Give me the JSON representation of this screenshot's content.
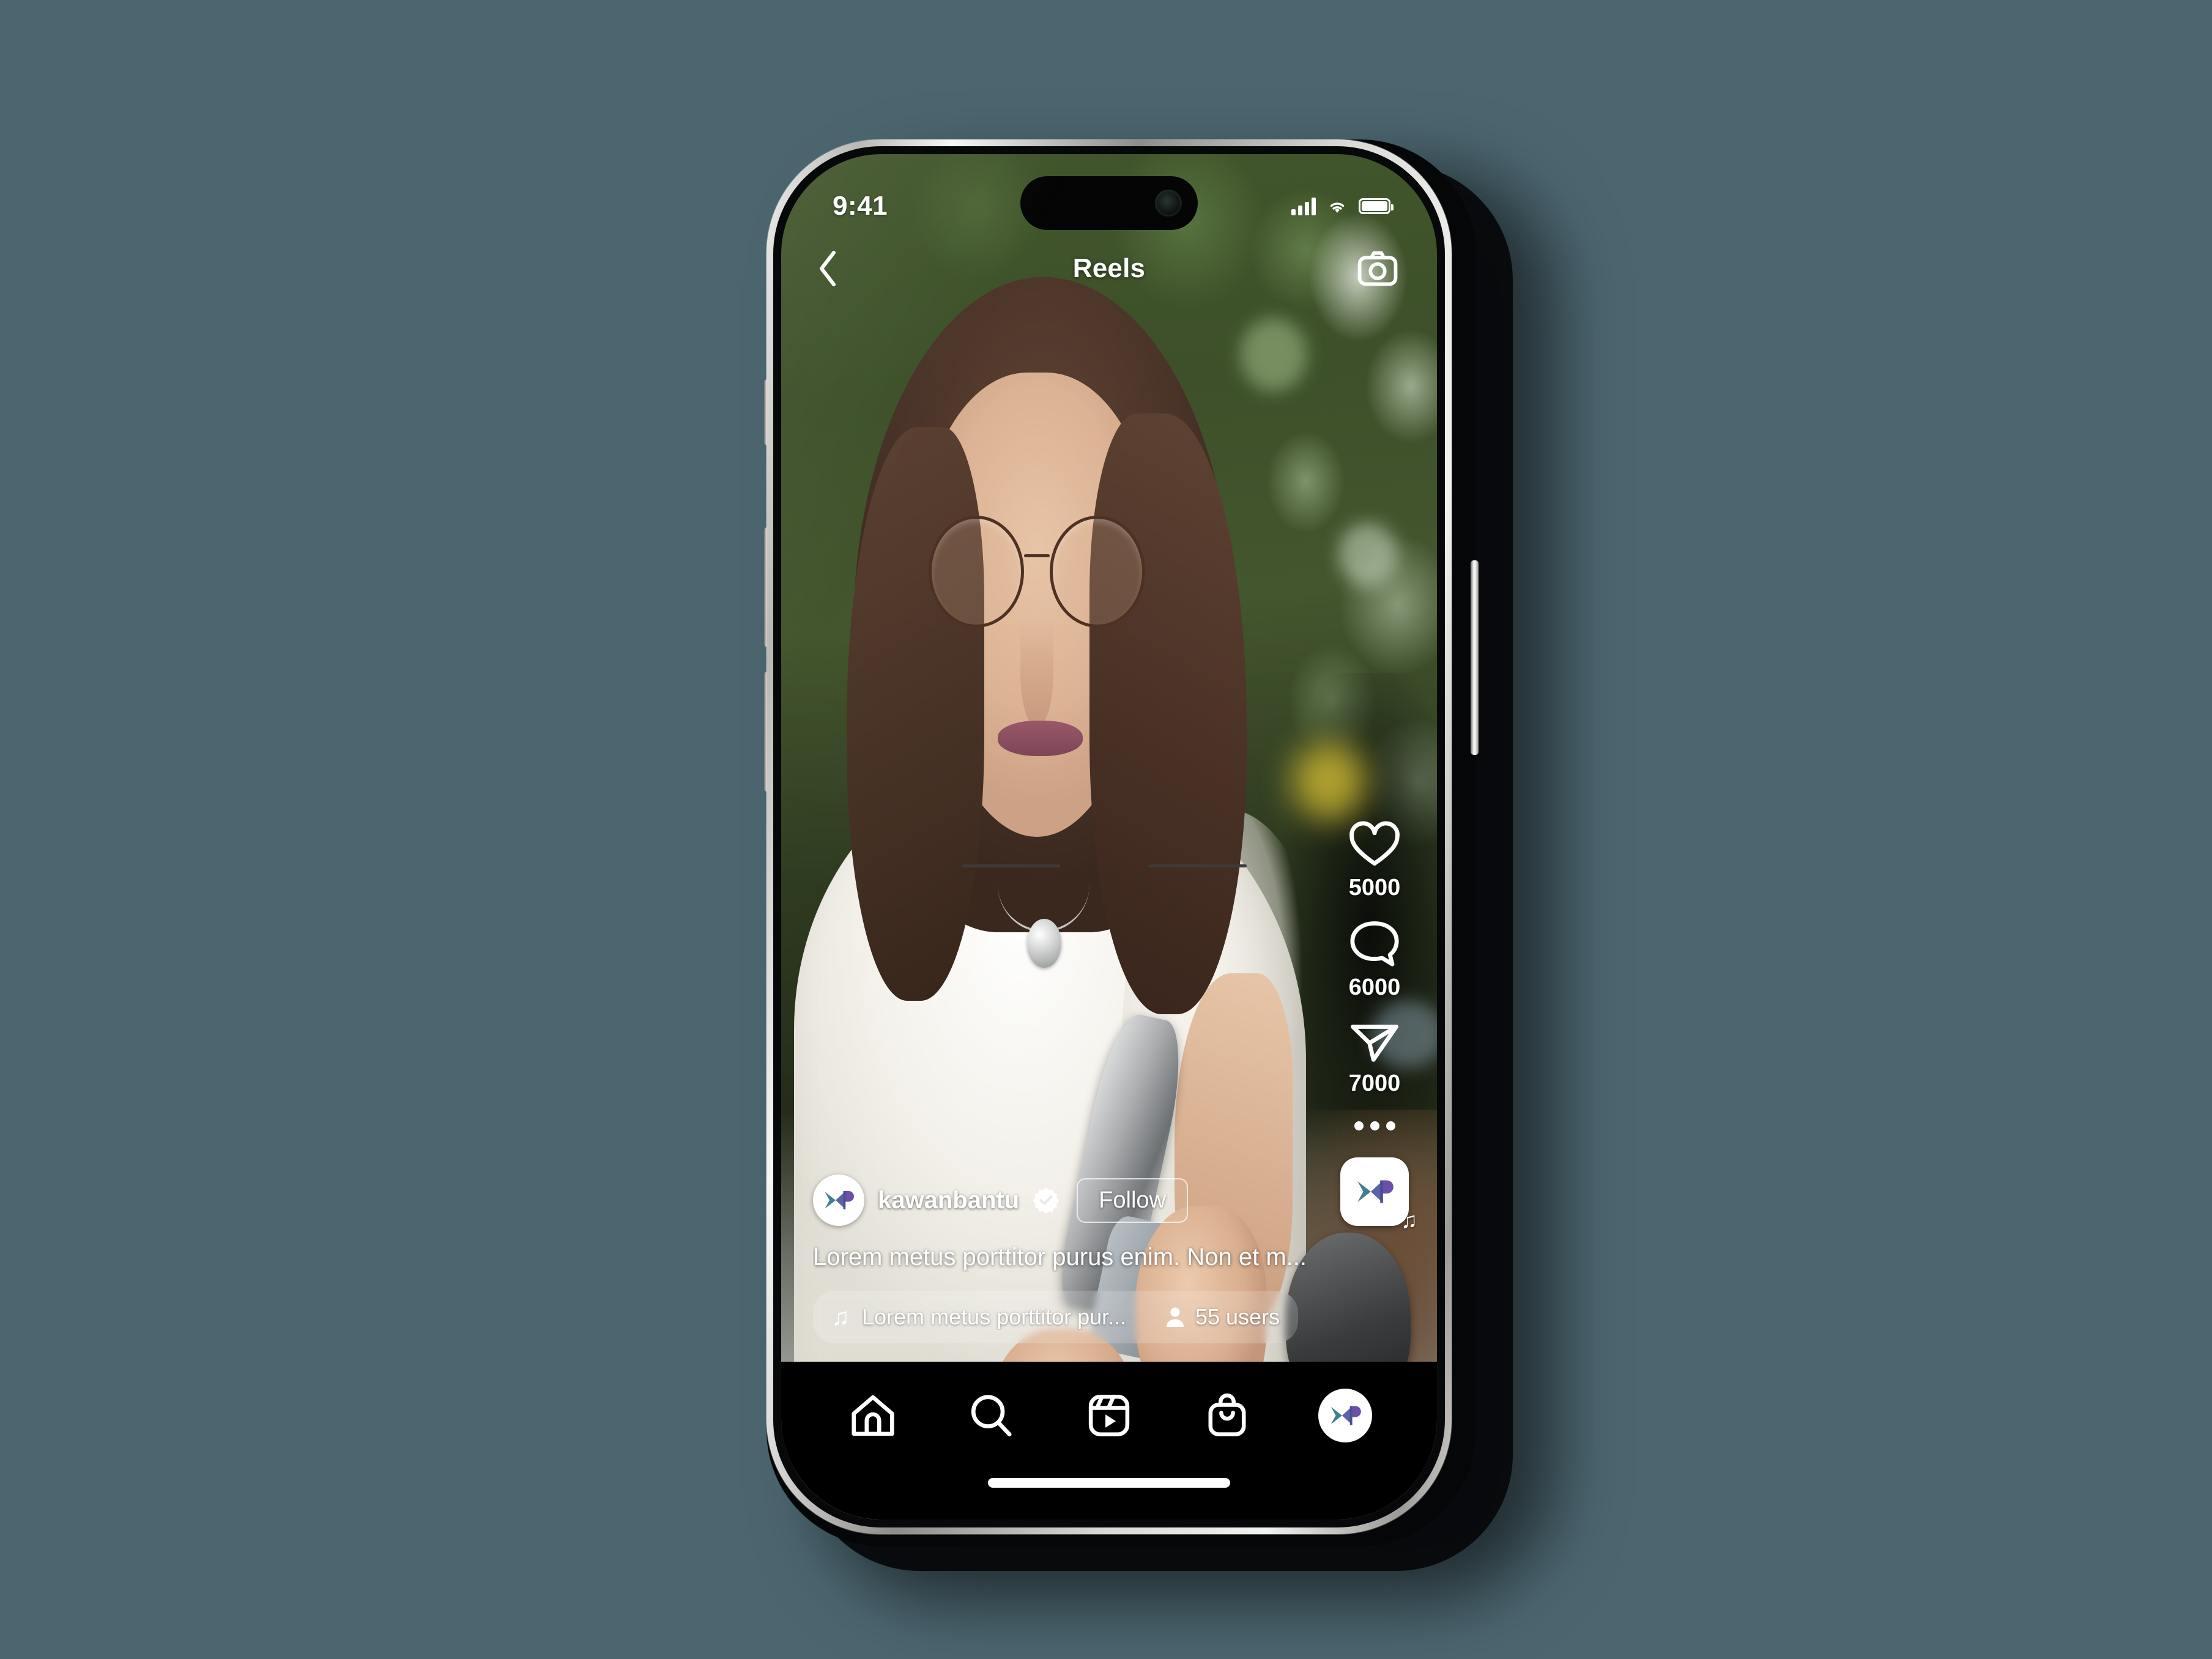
{
  "background_color": "#4c6670",
  "status_bar": {
    "time": "9:41",
    "cellular_icon": "cellular-signal-icon",
    "wifi_icon": "wifi-icon",
    "battery_icon": "battery-icon"
  },
  "header": {
    "back_icon": "chevron-left-icon",
    "title": "Reels",
    "camera_icon": "camera-icon"
  },
  "actions": [
    {
      "icon": "heart-icon",
      "name": "like",
      "count": "5000"
    },
    {
      "icon": "comment-icon",
      "name": "comment",
      "count": "6000"
    },
    {
      "icon": "share-icon",
      "name": "share",
      "count": "7000"
    }
  ],
  "more_icon": "more-options-icon",
  "album": {
    "icon": "album-art-logo",
    "logo_text": "XB",
    "badge_icon": "music-note-icon",
    "badge_glyph": "♫"
  },
  "post": {
    "avatar_logo": "XB",
    "username": "kawanbantu",
    "verified_icon": "verified-badge-icon",
    "follow_label": "Follow",
    "caption": "Lorem metus porttitor purus enim. Non et m...",
    "audio": {
      "music_icon": "music-note-icon",
      "music_glyph": "♫",
      "title": "Lorem metus porttitor pur...",
      "users_icon": "person-icon",
      "users_count": "55 users"
    }
  },
  "tabbar": [
    {
      "icon": "home-icon",
      "name": "home"
    },
    {
      "icon": "search-icon",
      "name": "search"
    },
    {
      "icon": "reels-icon",
      "name": "reels"
    },
    {
      "icon": "shop-icon",
      "name": "shop"
    },
    {
      "icon": "profile-avatar-icon",
      "name": "profile",
      "logo_text": "XB"
    }
  ],
  "brand_colors": {
    "logo_teal": "#3f7f93",
    "logo_purple": "#6b4fa8",
    "accent_yellow": "#d9c636"
  }
}
